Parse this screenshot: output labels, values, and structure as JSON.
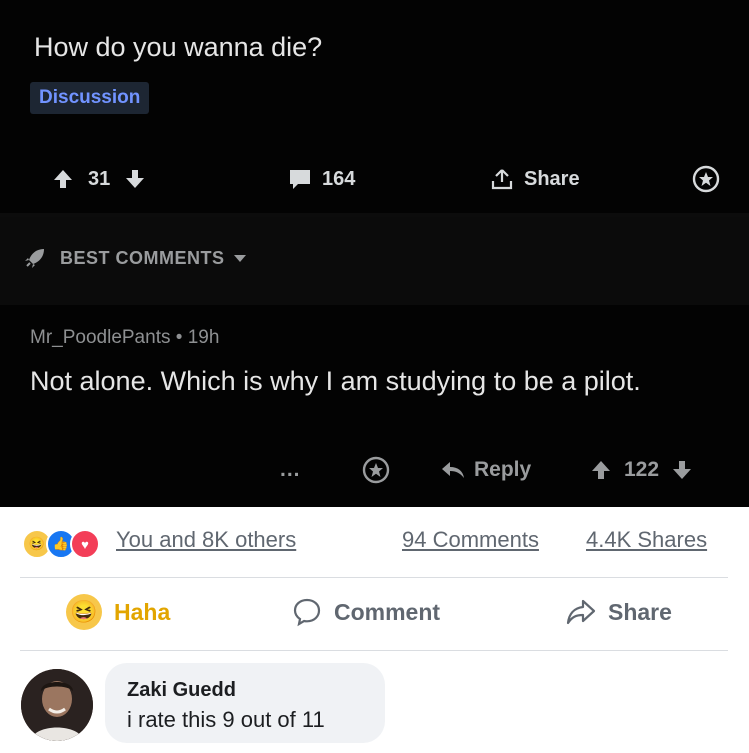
{
  "reddit": {
    "post_title": "How do you wanna die?",
    "flair": "Discussion",
    "upvotes": "31",
    "comments_count": "164",
    "share_label": "Share",
    "sort_label": "BEST COMMENTS",
    "comment": {
      "author": "Mr_PoodlePants",
      "age": "19h",
      "body": "Not alone.  Which is why I am studying to be a pilot.",
      "more": "...",
      "reply_label": "Reply",
      "score": "122"
    }
  },
  "facebook": {
    "reactions_text": "You and 8K others",
    "comments_text": "94 Comments",
    "shares_text": "4.4K Shares",
    "haha_label": "Haha",
    "comment_label": "Comment",
    "share_label": "Share",
    "reply": {
      "name": "Zaki Guedd",
      "text": "i rate this 9 out of 11"
    }
  }
}
